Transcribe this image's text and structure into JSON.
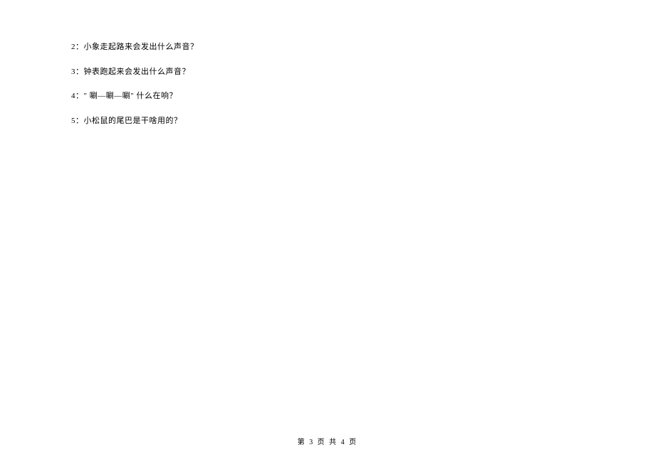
{
  "questions": [
    {
      "num": "2",
      "text": "小象走起路来会发出什么声音？"
    },
    {
      "num": "3",
      "text": "钟表跑起来会发出什么声音？"
    },
    {
      "num": "4",
      "text": "\" 唰—唰—唰\" 什么在响？"
    },
    {
      "num": "5",
      "text": "小松鼠的尾巴是干啥用的？"
    }
  ],
  "footer": {
    "prefix": "第",
    "current": "3",
    "middle1": "页",
    "middle2": "共",
    "total": "4",
    "suffix": "页"
  }
}
